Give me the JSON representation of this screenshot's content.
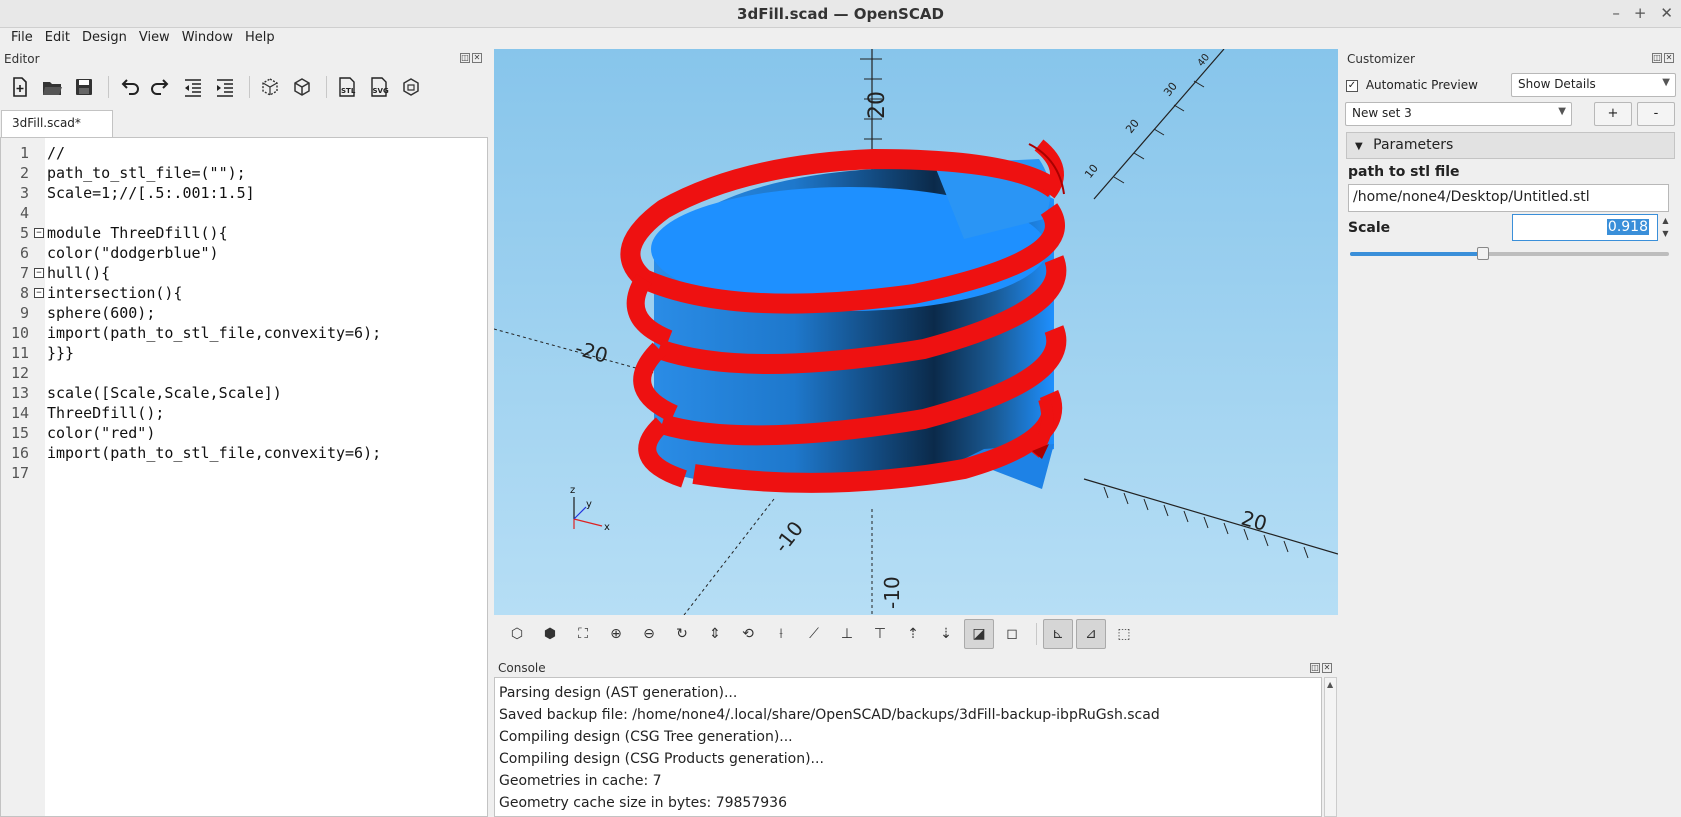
{
  "window": {
    "title": "3dFill.scad — OpenSCAD",
    "controls": [
      "–",
      "+",
      "✕"
    ]
  },
  "menu": [
    "File",
    "Edit",
    "Design",
    "View",
    "Window",
    "Help"
  ],
  "editor": {
    "panel_title": "Editor",
    "tab_label": "3dFill.scad*",
    "toolbar_icons": [
      "new-file-icon",
      "open-file-icon",
      "save-icon",
      "undo-icon",
      "redo-icon",
      "unindent-icon",
      "indent-icon",
      "preview-icon",
      "render-icon",
      "export-stl-icon",
      "export-svg-icon",
      "send-to-print-icon"
    ],
    "stl_label": "STL",
    "svg_label": "SVG",
    "lines": [
      {
        "n": "1",
        "text": "//"
      },
      {
        "n": "2",
        "text": "path_to_stl_file=(\"\");"
      },
      {
        "n": "3",
        "text": "Scale=1;//[.5:.001:1.5]"
      },
      {
        "n": "4",
        "text": ""
      },
      {
        "n": "5",
        "text": "module ThreeDfill(){",
        "fold": "−"
      },
      {
        "n": "6",
        "text": "color(\"dodgerblue\")"
      },
      {
        "n": "7",
        "text": "hull(){",
        "fold": "−"
      },
      {
        "n": "8",
        "text": "intersection(){",
        "fold": "−"
      },
      {
        "n": "9",
        "text": "sphere(600);"
      },
      {
        "n": "10",
        "text": "import(path_to_stl_file,convexity=6);"
      },
      {
        "n": "11",
        "text": "}}}"
      },
      {
        "n": "12",
        "text": ""
      },
      {
        "n": "13",
        "text": "scale([Scale,Scale,Scale])"
      },
      {
        "n": "14",
        "text": "ThreeDfill();"
      },
      {
        "n": "15",
        "text": "color(\"red\")"
      },
      {
        "n": "16",
        "text": "import(path_to_stl_file,convexity=6);"
      },
      {
        "n": "17",
        "text": ""
      }
    ]
  },
  "viewport": {
    "axis_labels": {
      "z_top": "20",
      "z_bottom": "-10",
      "x_pos": "20",
      "y_neg": "-10",
      "x_neg": "-20",
      "y_pos_10": "10",
      "y_pos_20": "20",
      "y_pos_30": "30",
      "y_pos_40": "40"
    },
    "gizmo": {
      "z": "z",
      "y": "y",
      "x": "x"
    },
    "colors": {
      "model_body": "#1e90ff",
      "model_coil": "#ee1111",
      "background_top": "#87c5eb",
      "background_bottom": "#b6def5"
    }
  },
  "view_toolbar": {
    "icons": [
      "preview-icon",
      "render-icon",
      "view-all-icon",
      "zoom-in-icon",
      "zoom-out-icon",
      "reset-view-icon",
      "view-center-icon",
      "view-rotate-icon",
      "view-right-icon",
      "view-left-icon",
      "view-back-icon",
      "view-front-icon",
      "view-top-icon",
      "view-bottom-icon",
      "perspective-icon",
      "orthogonal-icon",
      "show-axes-icon",
      "show-scale-icon",
      "show-edges-icon"
    ]
  },
  "console": {
    "panel_title": "Console",
    "lines": [
      "Parsing design (AST generation)...",
      "Saved backup file: /home/none4/.local/share/OpenSCAD/backups/3dFill-backup-ibpRuGsh.scad",
      "Compiling design (CSG Tree generation)...",
      "Compiling design (CSG Products generation)...",
      "Geometries in cache: 7",
      "Geometry cache size in bytes: 79857936"
    ]
  },
  "customizer": {
    "panel_title": "Customizer",
    "auto_preview_label": "Automatic Preview",
    "auto_preview_checked": "✓",
    "details_select": "Show Details",
    "preset_select": "New set 3",
    "add_button": "+",
    "remove_button": "-",
    "parameters_header": "Parameters",
    "path_label": "path to stl file",
    "path_value": "/home/none4/Desktop/Untitled.stl",
    "scale_label": "Scale",
    "scale_value": "0.918",
    "scale_fraction": 0.418
  }
}
